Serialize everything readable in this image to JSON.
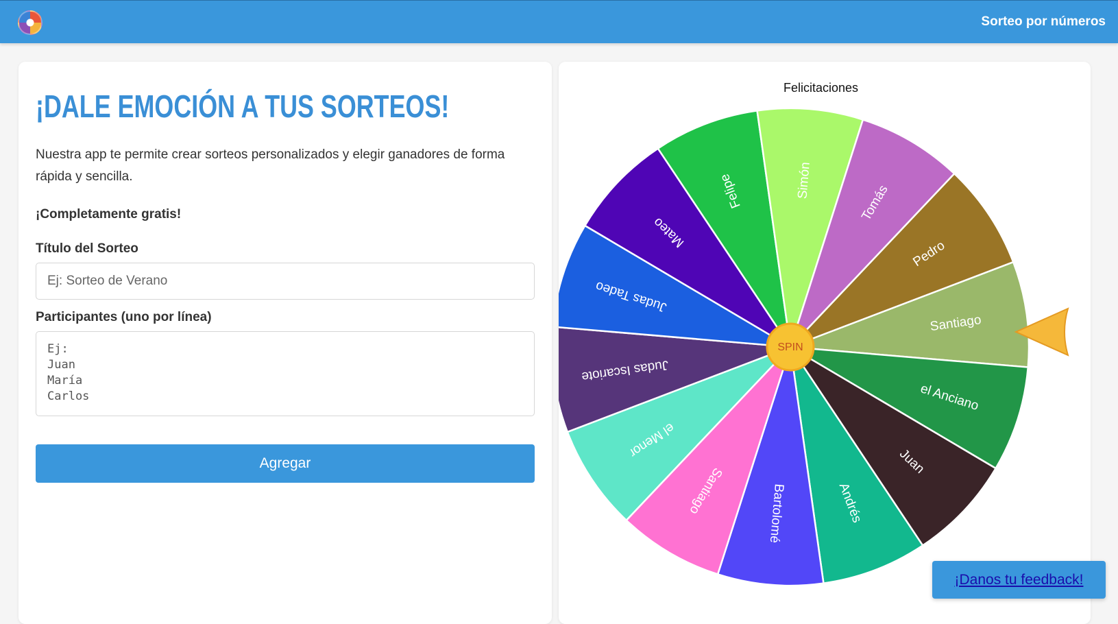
{
  "header": {
    "logo_icon": "colorful-wheel-logo",
    "nav_link": "Sorteo por números"
  },
  "hero": {
    "headline": "¡Dale emoción a tus sorteos!",
    "description": "Nuestra app te permite crear sorteos personalizados y elegir ganadores de forma rápida y sencilla.",
    "free_note": "¡Completamente gratis!"
  },
  "form": {
    "title_label": "Título del Sorteo",
    "title_placeholder": "Ej: Sorteo de Verano",
    "title_value": "",
    "participants_label": "Participantes (uno por línea)",
    "participants_placeholder": "Ej:\nJuan\nMaría\nCarlos",
    "participants_value": "",
    "add_button": "Agregar"
  },
  "wheel": {
    "title": "Felicitaciones",
    "spin_label": "SPIN",
    "pointer_color": "#f5b83a",
    "hub_color": "#f7c232",
    "segments": [
      {
        "name": "Santiago",
        "color": "#9ab86a"
      },
      {
        "name": "el Anciano",
        "color": "#229648"
      },
      {
        "name": "Juan",
        "color": "#3a2428"
      },
      {
        "name": "Andrés",
        "color": "#12b88e"
      },
      {
        "name": "Bartolomé",
        "color": "#5247f8"
      },
      {
        "name": "Santiago",
        "color": "#ff72d2"
      },
      {
        "name": "el Menor",
        "color": "#5ee6c8"
      },
      {
        "name": "Judas Iscariote",
        "color": "#56357a"
      },
      {
        "name": "Judas Tadeo",
        "color": "#1b5fe0"
      },
      {
        "name": "Mateo",
        "color": "#4f05b5"
      },
      {
        "name": "Felipe",
        "color": "#1fc248"
      },
      {
        "name": "Simón",
        "color": "#aaf86a"
      },
      {
        "name": "Tomás",
        "color": "#bd6ac6"
      },
      {
        "name": "Pedro",
        "color": "#9a7526"
      }
    ]
  },
  "feedback": {
    "label": "¡Danos tu feedback!"
  }
}
